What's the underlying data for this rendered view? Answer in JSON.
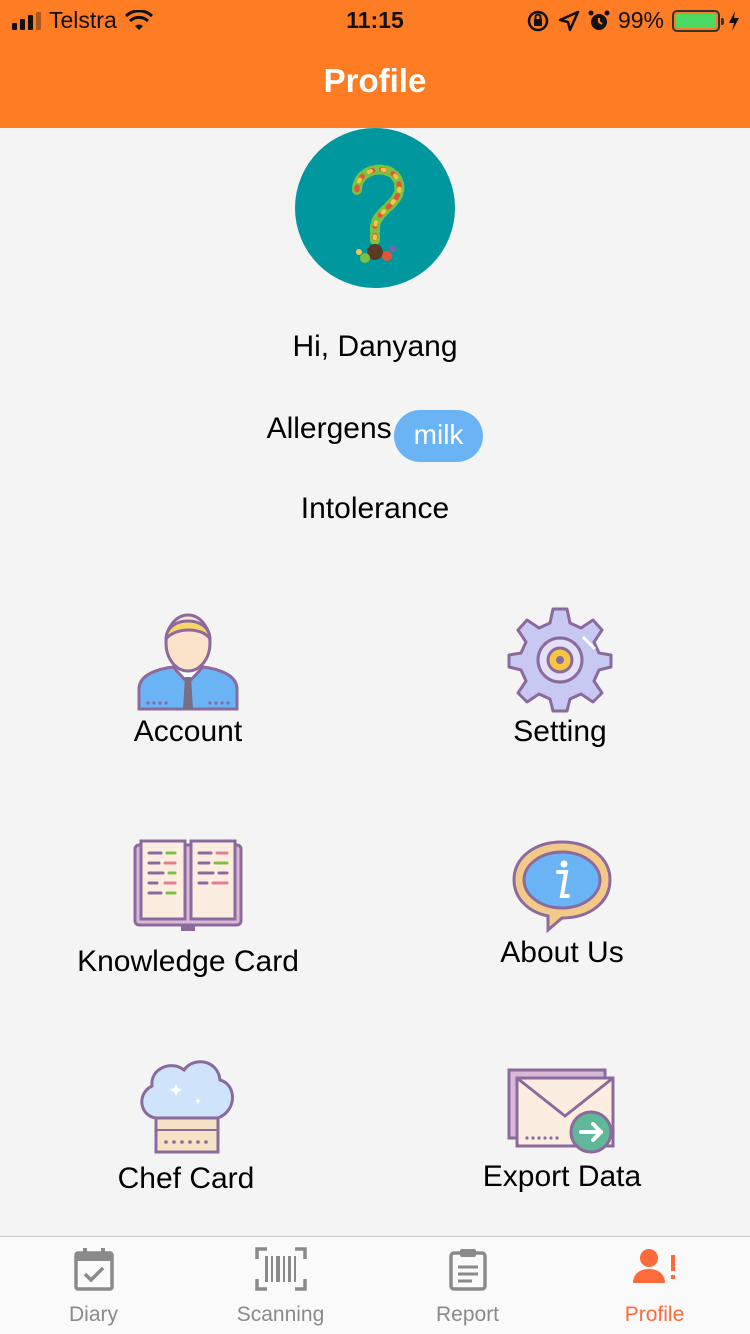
{
  "status_bar": {
    "carrier": "Telstra",
    "time": "11:15",
    "battery": "99%"
  },
  "nav": {
    "title": "Profile"
  },
  "profile": {
    "greeting": "Hi, Danyang",
    "allergens_label": "Allergens",
    "allergens": [
      "milk"
    ],
    "intolerance_label": "Intolerance"
  },
  "menu": {
    "account": "Account",
    "setting": "Setting",
    "knowledge_card": "Knowledge Card",
    "about_us": "About Us",
    "chef_card": "Chef Card",
    "export_data": "Export Data"
  },
  "tabs": [
    {
      "label": "Diary",
      "icon": "calendar-check-icon"
    },
    {
      "label": "Scanning",
      "icon": "barcode-icon"
    },
    {
      "label": "Report",
      "icon": "clipboard-icon"
    },
    {
      "label": "Profile",
      "icon": "user-alert-icon"
    }
  ],
  "colors": {
    "brand": "#fd7c24",
    "active_tab": "#fd6a3c",
    "chip": "#6ab4f6",
    "avatar_bg": "#00989e"
  }
}
